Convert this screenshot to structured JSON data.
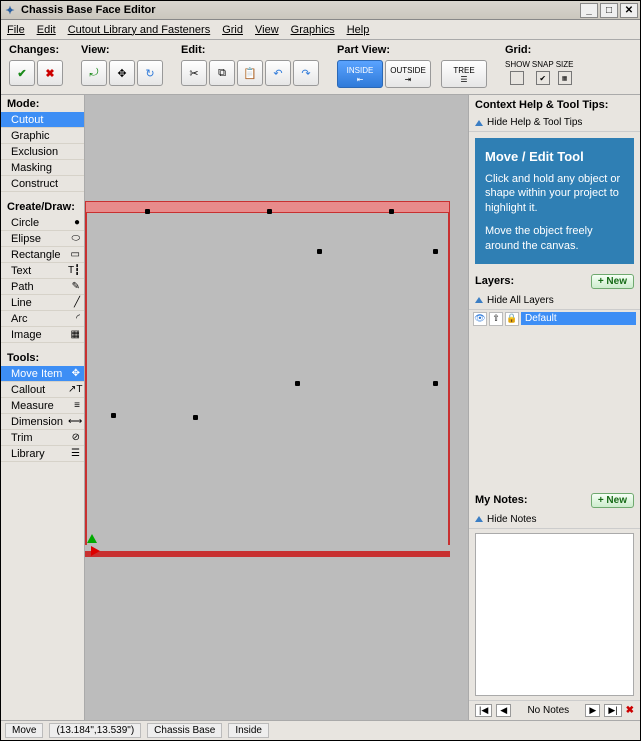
{
  "window": {
    "title": "Chassis Base Face Editor"
  },
  "menu": [
    "File",
    "Edit",
    "Cutout Library and Fasteners",
    "Grid",
    "View",
    "Graphics",
    "Help"
  ],
  "toolbar": {
    "changes": "Changes:",
    "view": "View:",
    "edit": "Edit:",
    "partview": "Part View:",
    "grid": "Grid:",
    "inside": "INSIDE",
    "outside": "OUTSIDE",
    "tree": "TREE",
    "gridcols": [
      "SHOW",
      "SNAP",
      "SIZE"
    ]
  },
  "left": {
    "mode_hdr": "Mode:",
    "modes": [
      "Cutout",
      "Graphic",
      "Exclusion",
      "Masking",
      "Construct"
    ],
    "create_hdr": "Create/Draw:",
    "create": [
      {
        "label": "Circle",
        "icon": "●"
      },
      {
        "label": "Elipse",
        "icon": "⬭"
      },
      {
        "label": "Rectangle",
        "icon": "▭"
      },
      {
        "label": "Text",
        "icon": "T┇"
      },
      {
        "label": "Path",
        "icon": "✎"
      },
      {
        "label": "Line",
        "icon": "╱"
      },
      {
        "label": "Arc",
        "icon": "◜"
      },
      {
        "label": "Image",
        "icon": "▦"
      }
    ],
    "tools_hdr": "Tools:",
    "tools": [
      {
        "label": "Move Item",
        "icon": "✥"
      },
      {
        "label": "Callout",
        "icon": "↗T"
      },
      {
        "label": "Measure",
        "icon": "≡"
      },
      {
        "label": "Dimension",
        "icon": "⟷"
      },
      {
        "label": "Trim",
        "icon": "⊘"
      },
      {
        "label": "Library",
        "icon": "☰"
      }
    ]
  },
  "tips": {
    "panel": "Context Help & Tool Tips:",
    "hide": "Hide Help & Tool Tips",
    "title": "Move / Edit Tool",
    "p1": "Click and hold any object or shape within your project to highlight it.",
    "p2": "Move the object freely around the canvas."
  },
  "layers": {
    "hdr": "Layers:",
    "new": "+ New",
    "hide": "Hide All Layers",
    "row": "Default"
  },
  "notes": {
    "hdr": "My Notes:",
    "new": "+ New",
    "hide": "Hide Notes",
    "nav": "No Notes"
  },
  "status": {
    "mode": "Move",
    "coord": "(13.184\",13.539\")",
    "part": "Chassis Base",
    "side": "Inside"
  }
}
